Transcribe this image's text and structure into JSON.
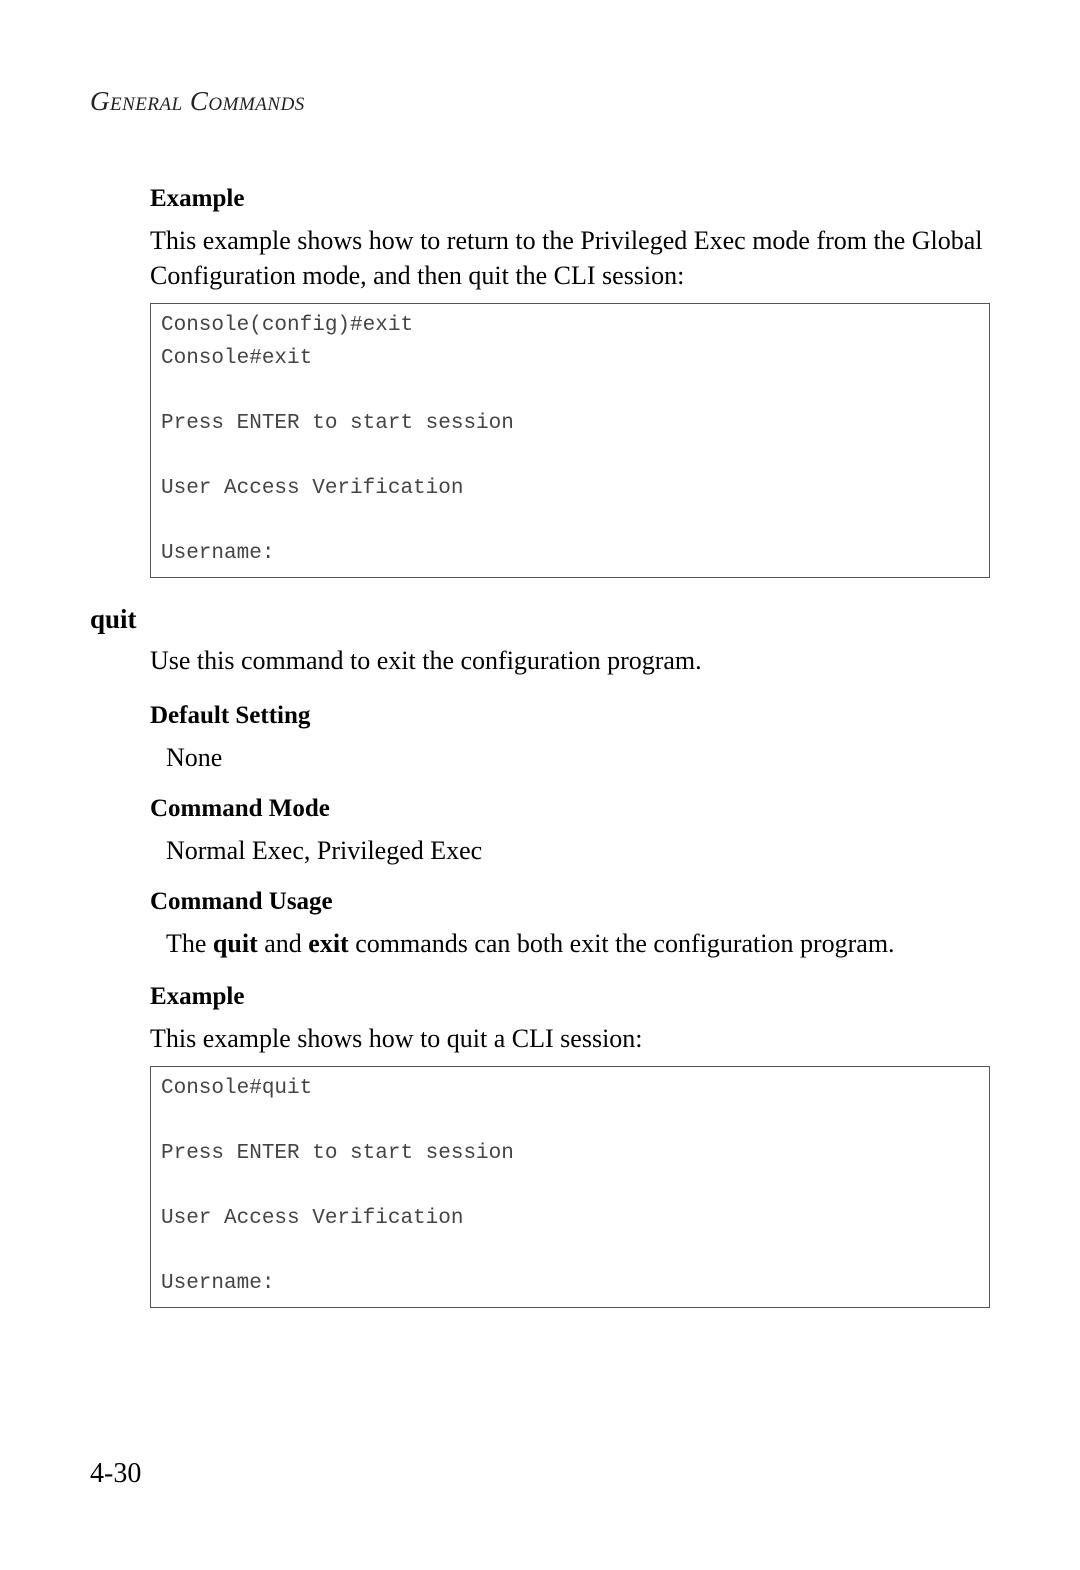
{
  "header": "General Commands",
  "sec1": {
    "example_label": "Example",
    "example_text": "This example shows how to return to the Privileged Exec mode from the Global Configuration mode, and then quit the CLI session:",
    "code": "Console(config)#exit\nConsole#exit\n\nPress ENTER to start session\n\nUser Access Verification\n\nUsername:"
  },
  "cmd": {
    "name": "quit",
    "desc": "Use this command to exit the configuration program.",
    "default_label": "Default Setting",
    "default_value": "None",
    "mode_label": "Command Mode",
    "mode_value": "Normal Exec, Privileged Exec",
    "usage_label": "Command Usage",
    "usage_pre": "The ",
    "usage_b1": "quit",
    "usage_mid": " and ",
    "usage_b2": "exit",
    "usage_post": " commands can both exit the configuration program.",
    "example_label": "Example",
    "example_text": "This example shows how to quit a CLI session:",
    "code": "Console#quit\n\nPress ENTER to start session\n\nUser Access Verification\n\nUsername:"
  },
  "page_number": "4-30"
}
